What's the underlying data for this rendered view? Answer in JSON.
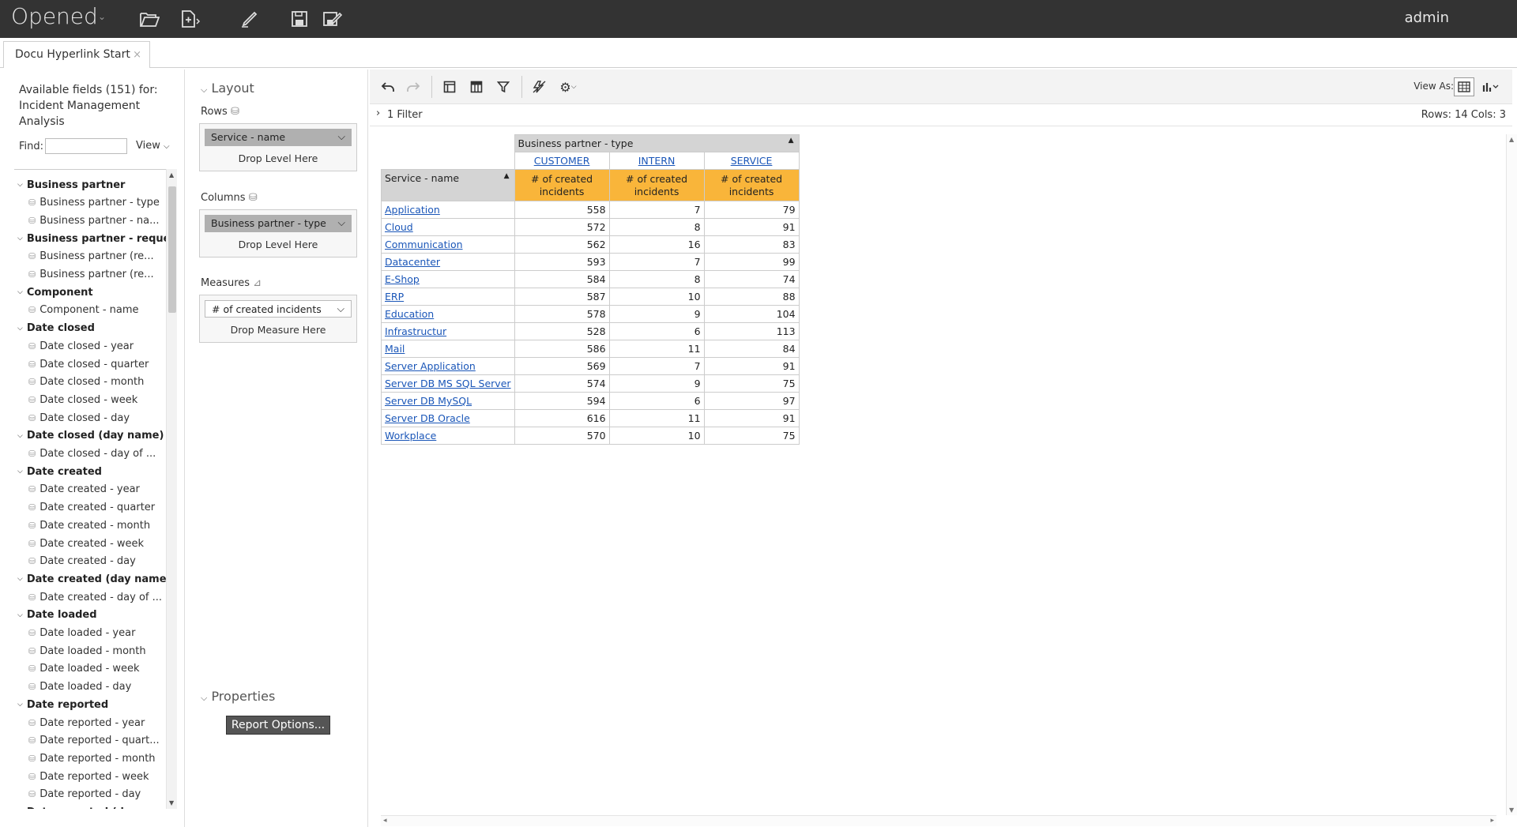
{
  "app": {
    "title": "Opened",
    "user": "admin"
  },
  "tabs": [
    {
      "label": "Docu Hyperlink Start",
      "close": "×"
    }
  ],
  "fields_panel": {
    "available_text": "Available fields (151) for: Incident Management Analysis",
    "find_label": "Find:",
    "find_value": "",
    "view_label": "View"
  },
  "tree": [
    {
      "label": "Business partner",
      "group": true
    },
    {
      "label": "Business partner - type",
      "group": false
    },
    {
      "label": "Business partner - na...",
      "group": false
    },
    {
      "label": "Business partner - reques...",
      "group": true
    },
    {
      "label": "Business partner (re...",
      "group": false
    },
    {
      "label": "Business partner (re...",
      "group": false
    },
    {
      "label": "Component",
      "group": true
    },
    {
      "label": "Component - name",
      "group": false
    },
    {
      "label": "Date closed",
      "group": true
    },
    {
      "label": "Date closed - year",
      "group": false
    },
    {
      "label": "Date closed - quarter",
      "group": false
    },
    {
      "label": "Date closed - month",
      "group": false
    },
    {
      "label": "Date closed - week",
      "group": false
    },
    {
      "label": "Date closed - day",
      "group": false
    },
    {
      "label": "Date closed (day name)",
      "group": true
    },
    {
      "label": "Date closed - day of ...",
      "group": false
    },
    {
      "label": "Date created",
      "group": true
    },
    {
      "label": "Date created - year",
      "group": false
    },
    {
      "label": "Date created - quarter",
      "group": false
    },
    {
      "label": "Date created - month",
      "group": false
    },
    {
      "label": "Date created - week",
      "group": false
    },
    {
      "label": "Date created - day",
      "group": false
    },
    {
      "label": "Date created (day name)",
      "group": true
    },
    {
      "label": "Date created - day of ...",
      "group": false
    },
    {
      "label": "Date loaded",
      "group": true
    },
    {
      "label": "Date loaded - year",
      "group": false
    },
    {
      "label": "Date loaded - month",
      "group": false
    },
    {
      "label": "Date loaded - week",
      "group": false
    },
    {
      "label": "Date loaded - day",
      "group": false
    },
    {
      "label": "Date reported",
      "group": true
    },
    {
      "label": "Date reported - year",
      "group": false
    },
    {
      "label": "Date reported - quart...",
      "group": false
    },
    {
      "label": "Date reported - month",
      "group": false
    },
    {
      "label": "Date reported - week",
      "group": false
    },
    {
      "label": "Date reported - day",
      "group": false
    },
    {
      "label": "Date reported (day name)",
      "group": true
    }
  ],
  "layout": {
    "title": "Layout",
    "rows_label": "Rows",
    "rows_chip": "Service - name",
    "columns_label": "Columns",
    "columns_chip": "Business partner - type",
    "measures_label": "Measures",
    "measures_chip": "# of created incidents",
    "drop_level": "Drop Level Here",
    "drop_measure": "Drop Measure Here",
    "properties_title": "Properties",
    "report_options": "Report Options..."
  },
  "toolbar": {
    "view_as": "View As:",
    "filter_text": "1 Filter",
    "rows_cols": "Rows: 14  Cols: 3"
  },
  "pivot": {
    "column_field": "Business partner - type",
    "row_field": "Service - name",
    "columns": [
      "CUSTOMER",
      "INTERN",
      "SERVICE"
    ],
    "measure_label": "# of created incidents",
    "rows": [
      {
        "name": "Application",
        "values": [
          558,
          7,
          79
        ]
      },
      {
        "name": "Cloud",
        "values": [
          572,
          8,
          91
        ]
      },
      {
        "name": "Communication",
        "values": [
          562,
          16,
          83
        ]
      },
      {
        "name": "Datacenter",
        "values": [
          593,
          7,
          99
        ]
      },
      {
        "name": "E-Shop",
        "values": [
          584,
          8,
          74
        ]
      },
      {
        "name": "ERP",
        "values": [
          587,
          10,
          88
        ]
      },
      {
        "name": "Education",
        "values": [
          578,
          9,
          104
        ]
      },
      {
        "name": "Infrastructur",
        "values": [
          528,
          6,
          113
        ]
      },
      {
        "name": "Mail",
        "values": [
          586,
          11,
          84
        ]
      },
      {
        "name": "Server Application",
        "values": [
          569,
          7,
          91
        ]
      },
      {
        "name": "Server DB MS SQL Server",
        "values": [
          574,
          9,
          75
        ]
      },
      {
        "name": "Server DB MySQL",
        "values": [
          594,
          6,
          97
        ]
      },
      {
        "name": "Server DB Oracle",
        "values": [
          616,
          11,
          91
        ]
      },
      {
        "name": "Workplace",
        "values": [
          570,
          10,
          75
        ]
      }
    ]
  },
  "colors": {
    "topbar": "#333333",
    "measure_header": "#f9b53a",
    "link": "#1a56b8"
  }
}
